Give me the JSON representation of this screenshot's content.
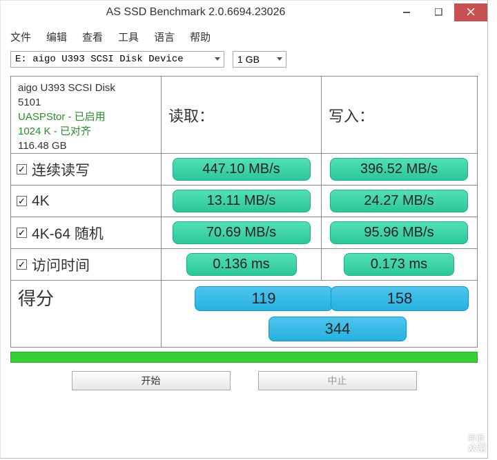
{
  "window": {
    "title": "AS SSD Benchmark 2.0.6694.23026"
  },
  "menu": {
    "file": "文件",
    "edit": "编辑",
    "view": "查看",
    "tools": "工具",
    "language": "语言",
    "help": "帮助"
  },
  "controls": {
    "drive": "E: aigo U393 SCSI Disk Device",
    "size": "1 GB"
  },
  "info": {
    "device": "aigo U393 SCSI Disk",
    "firmware": "5101",
    "uasp": "UASPStor - 已启用",
    "align": "1024 K - 已对齐",
    "capacity": "116.48 GB"
  },
  "headers": {
    "read": "读取：",
    "write": "写入："
  },
  "tests": {
    "seq": {
      "label": "连续读写",
      "read": "447.10 MB/s",
      "write": "396.52 MB/s"
    },
    "k4": {
      "label": "4K",
      "read": "13.11 MB/s",
      "write": "24.27 MB/s"
    },
    "k4_64": {
      "label": "4K-64 随机",
      "read": "70.69 MB/s",
      "write": "95.96 MB/s"
    },
    "access": {
      "label": "访问时间",
      "read": "0.136 ms",
      "write": "0.173 ms"
    }
  },
  "score": {
    "label": "得分",
    "read": "119",
    "write": "158",
    "total": "344"
  },
  "buttons": {
    "start": "开始",
    "abort": "中止"
  },
  "watermark": {
    "line1": "新浪",
    "line2": "众测"
  },
  "check": "✓"
}
